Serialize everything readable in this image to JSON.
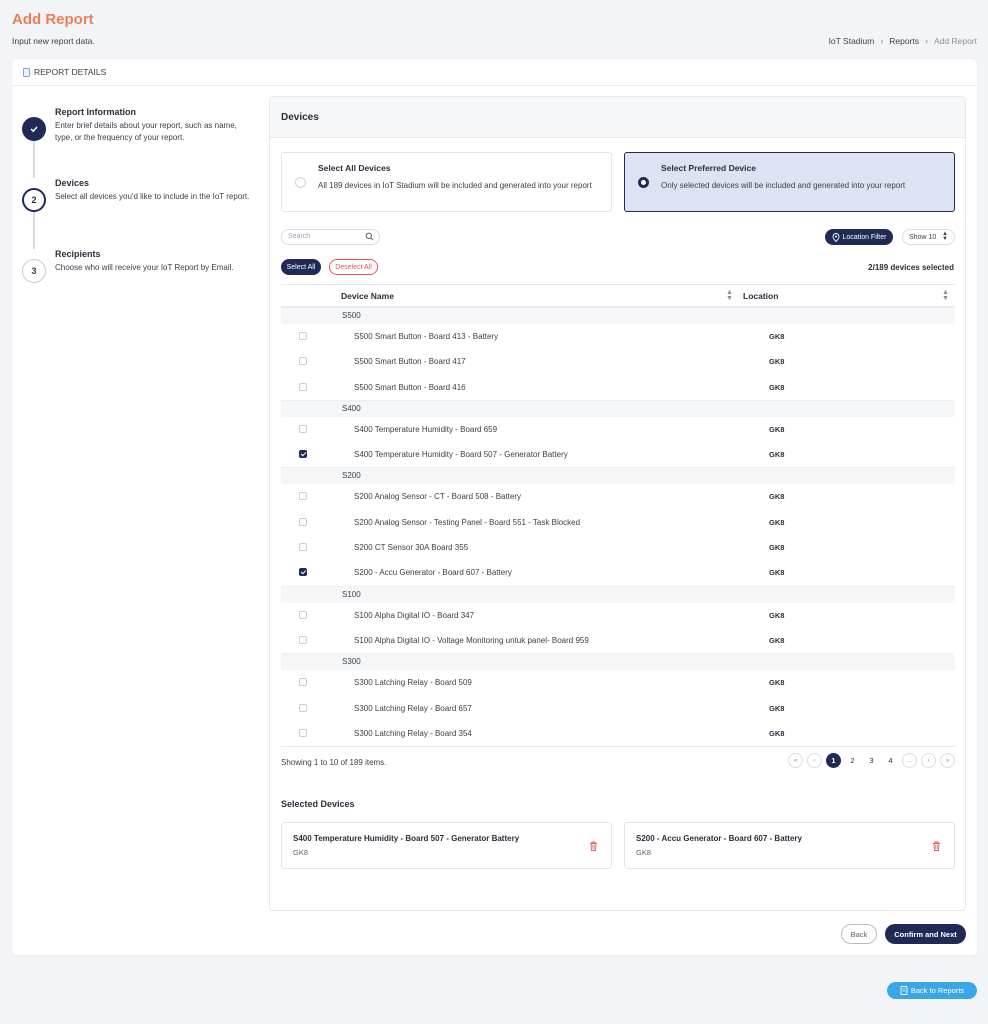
{
  "header": {
    "title": "Add Report",
    "subtitle": "Input new report data.",
    "breadcrumb": [
      "IoT Stadium",
      "Reports",
      "Add Report"
    ]
  },
  "card": {
    "title": "REPORT DETAILS"
  },
  "steps": [
    {
      "number": "",
      "title": "Report Information",
      "desc": "Enter brief details about your report, such as name, type, or the frequency of your report.",
      "state": "done"
    },
    {
      "number": "2",
      "title": "Devices",
      "desc": "Select all devices you'd like to include in the IoT report.",
      "state": "current"
    },
    {
      "number": "3",
      "title": "Recipients",
      "desc": "Choose who will receive your IoT Report by Email.",
      "state": "todo"
    }
  ],
  "devices_panel": {
    "title": "Devices",
    "option_all": {
      "title": "Select All Devices",
      "desc": "All 189 devices in IoT Stadium will be included and generated into your report"
    },
    "option_pref": {
      "title": "Select Preferred Device",
      "desc": "Only selected devices will be included and generated into your report"
    },
    "search_placeholder": "Search",
    "location_filter": "Location Filter",
    "show": "Show 10",
    "select_all": "Select All",
    "deselect_all": "Deselect All",
    "selected_count": "2/189 devices selected",
    "columns": {
      "name": "Device Name",
      "location": "Location"
    },
    "groups": [
      {
        "name": "S500",
        "rows": [
          {
            "name": "S500 Smart Button - Board 413 - Battery",
            "location": "GK8",
            "checked": false
          },
          {
            "name": "S500 Smart Button - Board 417",
            "location": "GK8",
            "checked": false
          },
          {
            "name": "S500 Smart Button - Board 416",
            "location": "GK8",
            "checked": false
          }
        ]
      },
      {
        "name": "S400",
        "rows": [
          {
            "name": "S400 Temperature Humidity - Board 659",
            "location": "GK8",
            "checked": false
          },
          {
            "name": "S400 Temperature Humidity - Board 507 - Generator Battery",
            "location": "GK8",
            "checked": true
          }
        ]
      },
      {
        "name": "S200",
        "rows": [
          {
            "name": "S200 Analog Sensor - CT - Board 508 - Battery",
            "location": "GK8",
            "checked": false
          },
          {
            "name": "S200 Analog Sensor - Testing Panel - Board 551 - Task Blocked",
            "location": "GK8",
            "checked": false
          },
          {
            "name": "S200 CT Sensor 30A Board 355",
            "location": "GK8",
            "checked": false
          },
          {
            "name": "S200 - Accu Generator - Board 607 - Battery",
            "location": "GK8",
            "checked": true
          }
        ]
      },
      {
        "name": "S100",
        "rows": [
          {
            "name": "S100 Alpha Digital IO - Board 347",
            "location": "GK8",
            "checked": false
          },
          {
            "name": "S100 Alpha Digital IO - Voltage Monitoring untuk panel- Board 959",
            "location": "GK8",
            "checked": false
          }
        ]
      },
      {
        "name": "S300",
        "rows": [
          {
            "name": "S300 Latching Relay - Board 509",
            "location": "GK8",
            "checked": false
          },
          {
            "name": "S300 Latching Relay - Board 657",
            "location": "GK8",
            "checked": false
          },
          {
            "name": "S300 Latching Relay - Board 354",
            "location": "GK8",
            "checked": false
          }
        ]
      }
    ],
    "showing": "Showing 1 to 10 of 189 items.",
    "pages": [
      "«",
      "‹",
      "1",
      "2",
      "3",
      "4",
      "...",
      "›",
      "»"
    ],
    "active_page": "1",
    "selected_title": "Selected Devices",
    "selected": [
      {
        "name": "S400 Temperature Humidity - Board 507 - Generator Battery",
        "location": "GK8"
      },
      {
        "name": "S200 - Accu Generator - Board 607 - Battery",
        "location": "GK8"
      }
    ]
  },
  "actions": {
    "back": "Back",
    "next": "Confirm and Next",
    "back_to_reports": "Back to Reports"
  },
  "colors": {
    "accent": "#ef7d57",
    "primary": "#1f2a55",
    "danger": "#e8565a",
    "info": "#3ba6e6"
  }
}
